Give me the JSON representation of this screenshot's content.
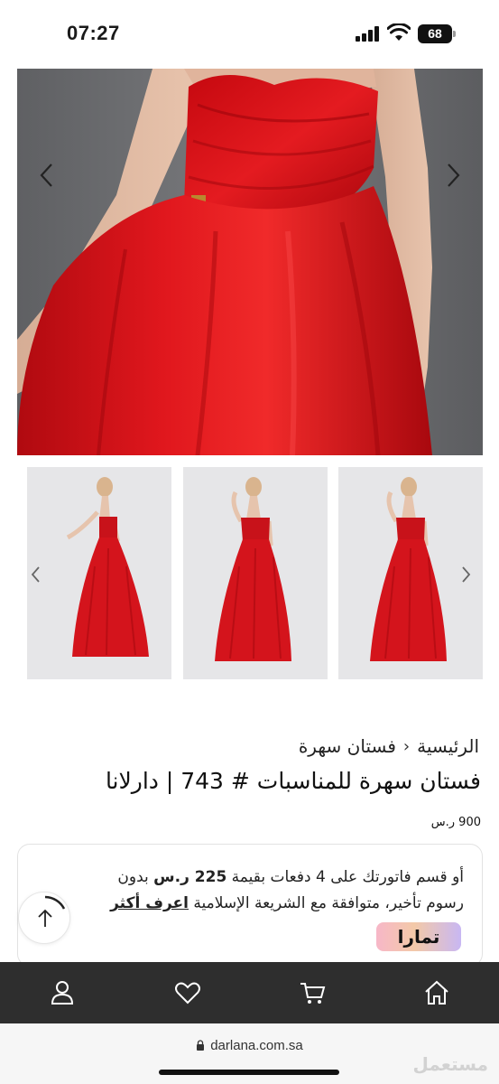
{
  "status_bar": {
    "time": "07:27",
    "battery": "68"
  },
  "gallery": {
    "main_image": "red-strapless-ball-gown-closeup",
    "thumbnails": [
      {
        "name": "model-side-pose"
      },
      {
        "name": "model-front-hand-raised"
      },
      {
        "name": "model-front-hand-raised"
      }
    ]
  },
  "breadcrumb": {
    "home": "الرئيسية",
    "separator": "‹",
    "category": "فستان سهرة"
  },
  "product": {
    "title": "فستان سهرة للمناسبات # 743 | دارلانا",
    "price": "900 ر.س"
  },
  "tamara": {
    "line1_prefix": "أو قسم فاتورتك على 4 دفعات بقيمة ",
    "installment": "225 ر.س",
    "line1_suffix": " بدون",
    "line2": "رسوم تأخير، متوافقة مع الشريعة الإسلامية ",
    "learn_more": "اعرف أكثر",
    "logo_text": "تمارا"
  },
  "bottom_nav": {
    "items": [
      "user-icon",
      "heart-icon",
      "cart-icon",
      "home-icon"
    ]
  },
  "browser": {
    "url": "darlana.com.sa"
  },
  "watermark": "مستعمل",
  "colors": {
    "dress_red": "#d9141a",
    "nav_bg": "#2e2e2e",
    "backdrop": "#6b6b6e"
  }
}
